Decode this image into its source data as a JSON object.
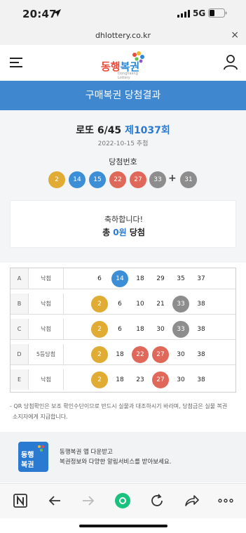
{
  "status_bar": {
    "time": "20:47",
    "network": "5G"
  },
  "url_bar": {
    "url": "dhlottery.co.kr",
    "close": "×"
  },
  "header": {
    "logo_part1": "동행",
    "logo_part2": "복권",
    "logo_sub": "Donghaeng Lottery"
  },
  "page_title": "구매복권 당첨결과",
  "draw": {
    "game": "로또 6/45",
    "round": "제1037회",
    "date": "2022-10-15 추첨",
    "label": "당첨번호",
    "numbers": [
      "2",
      "14",
      "15",
      "22",
      "27",
      "33"
    ],
    "bonus": "31",
    "plus": "+"
  },
  "result": {
    "congrats": "축하합니다!",
    "total_prefix": "총 ",
    "amount": "0원",
    "total_suffix": " 당첨"
  },
  "colors": {
    "yellow": "#e0ac34",
    "blue": "#3c8fd6",
    "red": "#e0685a",
    "gray": "#8d8d8d",
    "accent": "#3f87cf"
  },
  "ticket": {
    "rows": [
      {
        "id": "A",
        "result": "낙첨",
        "numbers": [
          "6",
          "14",
          "18",
          "29",
          "35",
          "37"
        ]
      },
      {
        "id": "B",
        "result": "낙첨",
        "numbers": [
          "2",
          "6",
          "10",
          "21",
          "33",
          "38"
        ]
      },
      {
        "id": "C",
        "result": "낙첨",
        "numbers": [
          "2",
          "6",
          "18",
          "30",
          "33",
          "38"
        ]
      },
      {
        "id": "D",
        "result": "5등당첨",
        "numbers": [
          "2",
          "18",
          "22",
          "27",
          "30",
          "38"
        ]
      },
      {
        "id": "E",
        "result": "낙첨",
        "numbers": [
          "2",
          "18",
          "23",
          "27",
          "30",
          "38"
        ]
      }
    ]
  },
  "note_line1": "- QR 당첨확인은 보조 확인수단이므로 반드시 실물과 대조하시기 바라며, 당첨금은 실물 복권",
  "note_line2": "소지자에게 지급합니다.",
  "banner": {
    "icon_line1": "동행",
    "icon_line2": "복권",
    "line1": "동행복권 앱 다운받고",
    "line2": "복권정보와 다양한 알림서비스를 받아보세요."
  },
  "toolbar_icons": [
    "naver-icon",
    "back-icon",
    "forward-icon",
    "home-icon",
    "reload-icon",
    "share-icon",
    "more-icon"
  ]
}
